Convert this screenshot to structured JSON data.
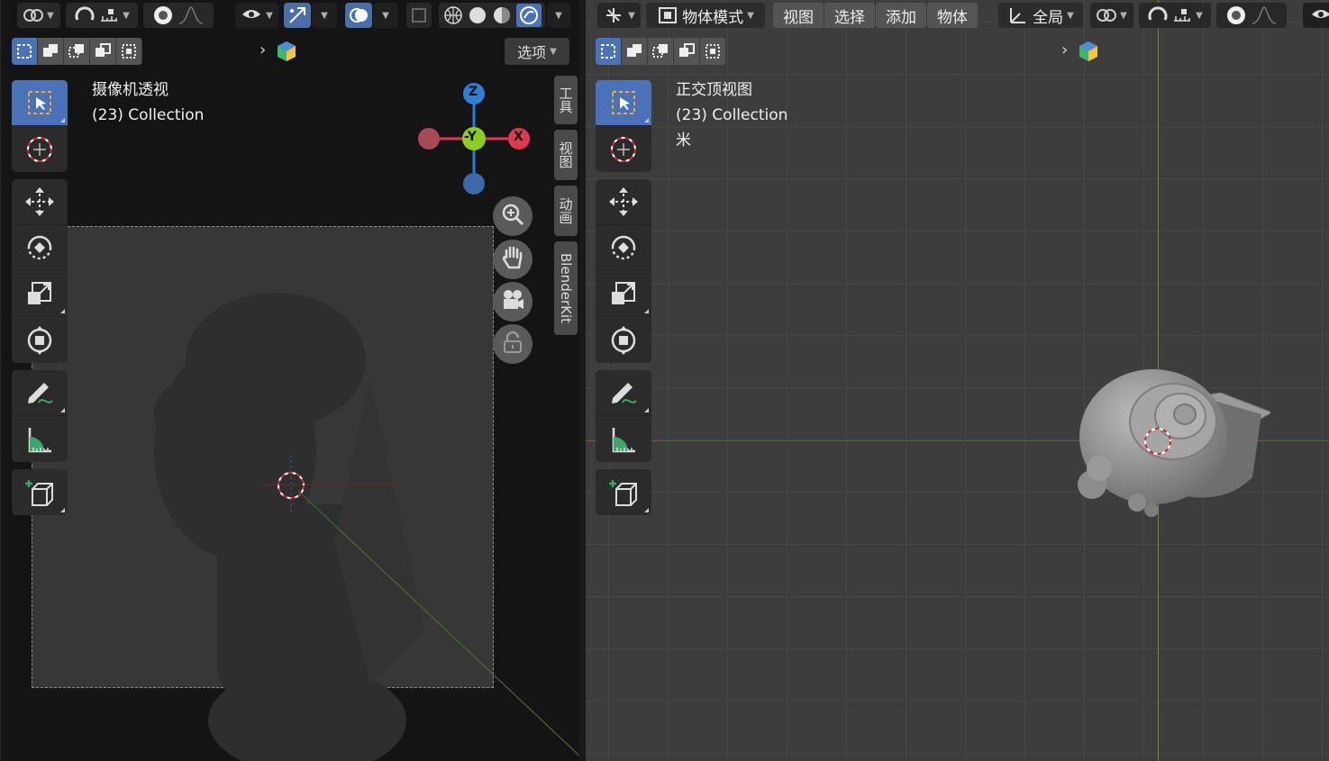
{
  "left_viewport": {
    "view_name": "摄像机透视",
    "collection": "(23) Collection",
    "options_label": "选项",
    "gizmo": {
      "z_label": "Z",
      "y_label": "-Y",
      "x_label": "X"
    },
    "side_tabs": [
      "工具",
      "视图",
      "动画",
      "BlenderKit"
    ]
  },
  "right_viewport": {
    "view_name": "正交顶视图",
    "collection": "(23) Collection",
    "units": "米",
    "mode_label": "物体模式",
    "menus": [
      "视图",
      "选择",
      "添加",
      "物体"
    ],
    "transform_orientation": "全局"
  },
  "colors": {
    "accent": "#4a72b8",
    "axis_x": "#e0394f",
    "axis_y": "#8ccd1f",
    "axis_z": "#2e7ed6",
    "cursor_red": "#d0283a"
  }
}
